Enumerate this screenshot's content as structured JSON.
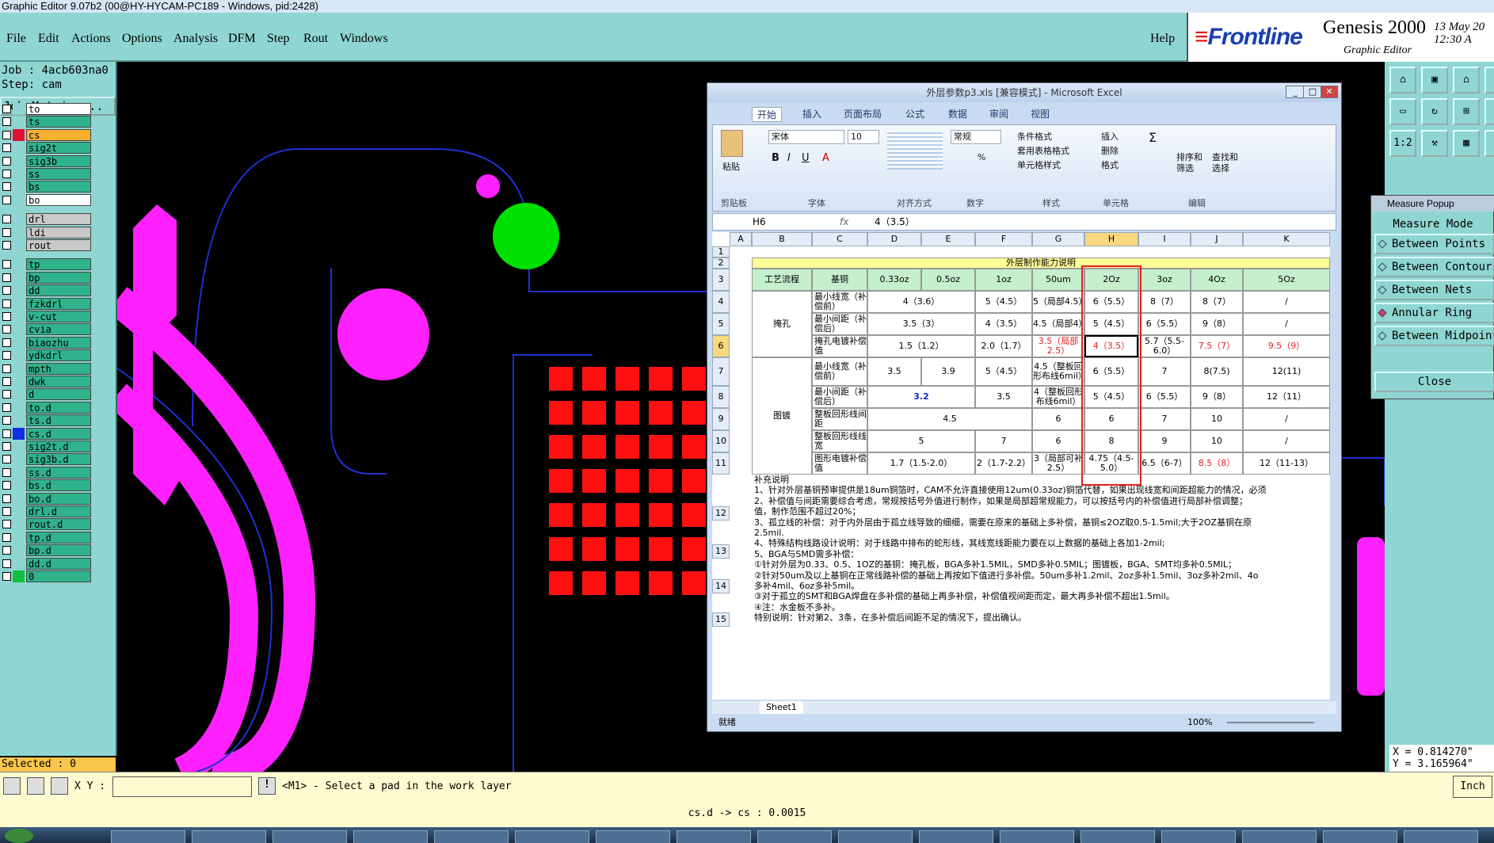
{
  "window": {
    "title": "Graphic Editor 9.07b2 (00@HY-HYCAM-PC189 - Windows, pid:2428)"
  },
  "menu": {
    "items": [
      "File",
      "Edit",
      "Actions",
      "Options",
      "Analysis",
      "DFM",
      "Step",
      "Rout",
      "Windows"
    ],
    "help": "Help"
  },
  "brand": {
    "logo": "Frontline",
    "product": "Genesis 2000",
    "subtitle": "Graphic Editor",
    "datetime": "13 May 20\n12:30 A"
  },
  "info": {
    "job": "Job : 4acb603na0",
    "step": "Step: cam",
    "job_matrix": "Job Matrix ..."
  },
  "layers": [
    {
      "name": "to",
      "color": "#8fd6d2",
      "bg": "#ffffff"
    },
    {
      "name": "ts",
      "color": "#8fd6d2",
      "bg": "#2fb38a"
    },
    {
      "name": "cs",
      "color": "#e01030",
      "bg": "#f8b030"
    },
    {
      "name": "sig2t",
      "color": "#8fd6d2",
      "bg": "#2fb38a"
    },
    {
      "name": "sig3b",
      "color": "#8fd6d2",
      "bg": "#2fb38a"
    },
    {
      "name": "ss",
      "color": "#8fd6d2",
      "bg": "#2fb38a"
    },
    {
      "name": "bs",
      "color": "#8fd6d2",
      "bg": "#2fb38a"
    },
    {
      "name": "bo",
      "color": "#8fd6d2",
      "bg": "#ffffff"
    },
    {
      "name": "drl",
      "color": "#8fd6d2",
      "bg": "#c8c8c8"
    },
    {
      "name": "ldi",
      "color": "#8fd6d2",
      "bg": "#c8c8c8"
    },
    {
      "name": "rout",
      "color": "#8fd6d2",
      "bg": "#c8c8c8"
    },
    {
      "name": "tp",
      "color": "#8fd6d2",
      "bg": "#2fb38a"
    },
    {
      "name": "bp",
      "color": "#8fd6d2",
      "bg": "#2fb38a"
    },
    {
      "name": "dd",
      "color": "#8fd6d2",
      "bg": "#2fb38a"
    },
    {
      "name": "fzkdrl",
      "color": "#8fd6d2",
      "bg": "#2fb38a"
    },
    {
      "name": "v-cut",
      "color": "#8fd6d2",
      "bg": "#2fb38a"
    },
    {
      "name": "cvia",
      "color": "#8fd6d2",
      "bg": "#2fb38a"
    },
    {
      "name": "biaozhu",
      "color": "#8fd6d2",
      "bg": "#2fb38a"
    },
    {
      "name": "ydkdrl",
      "color": "#8fd6d2",
      "bg": "#2fb38a"
    },
    {
      "name": "mpth",
      "color": "#8fd6d2",
      "bg": "#2fb38a"
    },
    {
      "name": "dwk",
      "color": "#8fd6d2",
      "bg": "#2fb38a"
    },
    {
      "name": "d",
      "color": "#8fd6d2",
      "bg": "#2fb38a"
    },
    {
      "name": "to.d",
      "color": "#8fd6d2",
      "bg": "#2fb38a"
    },
    {
      "name": "ts.d",
      "color": "#8fd6d2",
      "bg": "#2fb38a"
    },
    {
      "name": "cs.d",
      "color": "#1030e0",
      "bg": "#2fb38a"
    },
    {
      "name": "sig2t.d",
      "color": "#8fd6d2",
      "bg": "#2fb38a"
    },
    {
      "name": "sig3b.d",
      "color": "#8fd6d2",
      "bg": "#2fb38a"
    },
    {
      "name": "ss.d",
      "color": "#8fd6d2",
      "bg": "#2fb38a"
    },
    {
      "name": "bs.d",
      "color": "#8fd6d2",
      "bg": "#2fb38a"
    },
    {
      "name": "bo.d",
      "color": "#8fd6d2",
      "bg": "#2fb38a"
    },
    {
      "name": "drl.d",
      "color": "#8fd6d2",
      "bg": "#2fb38a"
    },
    {
      "name": "rout.d",
      "color": "#8fd6d2",
      "bg": "#2fb38a"
    },
    {
      "name": "tp.d",
      "color": "#8fd6d2",
      "bg": "#2fb38a"
    },
    {
      "name": "bp.d",
      "color": "#8fd6d2",
      "bg": "#2fb38a"
    },
    {
      "name": "dd.d",
      "color": "#8fd6d2",
      "bg": "#2fb38a"
    },
    {
      "name": "0",
      "color": "#10c040",
      "bg": "#2fb38a"
    }
  ],
  "selected": "Selected : 0",
  "excel": {
    "title": "外层参数p3.xls  [兼容模式] - Microsoft Excel",
    "tabs": [
      "开始",
      "插入",
      "页面布局",
      "公式",
      "数据",
      "审阅",
      "视图"
    ],
    "groups": [
      "剪贴板",
      "字体",
      "对齐方式",
      "数字",
      "样式",
      "单元格",
      "编辑"
    ],
    "font_name": "宋体",
    "font_size": "10",
    "number_format": "常规",
    "ribbon_labels": {
      "paste": "粘贴",
      "cond": "条件格式",
      "table": "套用表格格式",
      "cellstyle": "单元格样式",
      "insert": "插入",
      "delete": "删除",
      "format": "格式",
      "sort": "排序和\n筛选",
      "find": "查找和\n选择"
    },
    "namebox": "H6",
    "formula": "4（3.5）",
    "columns": [
      "A",
      "B",
      "C",
      "D",
      "E",
      "F",
      "G",
      "H",
      "I",
      "J",
      "K"
    ],
    "sheet_title": "外层制作能力说明",
    "headers": [
      "工艺流程",
      "基铜",
      "0.33oz",
      "0.5oz",
      "1oz",
      "50um",
      "2Oz",
      "3oz",
      "4Oz",
      "5Oz"
    ],
    "groupA": "掩孔",
    "groupB": "图镀",
    "rows": [
      {
        "n": "4",
        "label": "最小线宽（补偿前）",
        "d": "4（3.6）",
        "f": "5（4.5）",
        "g": "5（局部4.5）",
        "h": "6（5.5）",
        "i": "8（7）",
        "j": "8（7）",
        "k": "/"
      },
      {
        "n": "5",
        "label": "最小间距（补偿后）",
        "d": "3.5（3）",
        "f": "4（3.5）",
        "g": "4.5（局部4）",
        "h": "5（4.5）",
        "i": "6（5.5）",
        "j": "9（8）",
        "k": "/"
      },
      {
        "n": "6",
        "label": "掩孔电镀补偿值",
        "d": "1.5（1.2）",
        "f": "2.0（1.7）",
        "g": "3.5（局部2.5）",
        "h": "4（3.5）",
        "i": "5.7（5.5-6.0）",
        "j": "7.5（7）",
        "k": "9.5（9）"
      },
      {
        "n": "7",
        "label": "最小线宽（补偿前）",
        "d": "3.5",
        "e": "3.9",
        "f": "5（4.5）",
        "g": "4.5（整板回形布线6mil）",
        "h": "6（5.5）",
        "i": "7",
        "j": "8(7.5)",
        "k": "12(11)"
      },
      {
        "n": "8",
        "label": "最小间距（补偿后）",
        "d": "3.2",
        "f": "3.5",
        "g": "4（整板回形布线6mil）",
        "h": "5（4.5）",
        "i": "6（5.5）",
        "j": "9（8）",
        "k": "12（11）"
      },
      {
        "n": "9",
        "label": "整板回形线间距",
        "d": "4.5",
        "g": "6",
        "h": "6",
        "i": "7",
        "j": "10",
        "k": "/"
      },
      {
        "n": "10",
        "label": "整板回形线线宽",
        "d": "5",
        "f": "7",
        "g": "6",
        "h": "8",
        "i": "9",
        "j": "10",
        "k": "/"
      },
      {
        "n": "11",
        "label": "图形电镀补偿值",
        "d": "1.7（1.5-2.0）",
        "f": "2（1.7-2.2）",
        "g": "3（局部可补2.5）",
        "h": "4.75（4.5-5.0）",
        "i": "6.5（6-7）",
        "j": "8.5（8）",
        "k": "12（11-13）"
      }
    ],
    "notes": [
      "补充说明",
      "1、针对外层基铜预审提供是18um铜箔时，CAM不允许直接使用12um(0.33oz)铜箔代替，如果出现线宽和间距超能力的情况，必须",
      "2、补偿值与间距需要综合考虑，常规按括号外值进行制作，如果是局部超常规能力，可以按括号内的补偿值进行局部补偿调整；",
      "值，制作范围不超过20%；",
      "3、孤立线的补偿：对于内外层由于孤立线导致的细细，需要在原来的基础上多补偿，基铜≤2OZ取0.5-1.5mil;大于2OZ基铜在原",
      "2.5mil.",
      "4、特殊结构线路设计说明：对于线路中排布的蛇形线，其线宽线距能力要在以上数据的基础上各加1-2mil;",
      "5、BGA与SMD需多补偿：",
      "①针对外层为0.33、0.5、1OZ的基铜：掩孔板，BGA多补1.5MIL，SMD多补0.5MIL；图镀板，BGA、SMT均多补0.5MIL；",
      "②针对50um及以上基铜在正常线路补偿的基础上再按如下值进行多补偿。50um多补1.2mil、2oz多补1.5mil、3oz多补2mil、4o",
      "多补4mil、6oz多补5mil。",
      "③对于孤立的SMT和BGA焊盘在多补偿的基础上再多补偿，补偿值视间距而定，最大再多补偿不超出1.5mil。",
      "④注：水金板不多补。",
      "特别说明：针对第2、3条，在多补偿后间距不足的情况下，提出确认。"
    ],
    "note_rows": [
      "12",
      "13",
      "14",
      "15"
    ],
    "sheet": "Sheet1",
    "status": "就绪",
    "zoom": "100%"
  },
  "measure": {
    "title": "Measure Popup",
    "mode": "Measure Mode",
    "options": [
      "Between Points",
      "Between Contours",
      "Between Nets",
      "Annular Ring",
      "Between Midpoints"
    ],
    "selected": "Annular Ring",
    "close": "Close"
  },
  "coords": "X = 0.814270\"\nY = 3.165964\"",
  "cmd": {
    "xy_label": "X Y :",
    "xy_value": "",
    "prompt": "<M1> - Select a pad in the work layer",
    "unit": "Inch"
  },
  "status_line": "cs.d -> cs : 0.0015"
}
